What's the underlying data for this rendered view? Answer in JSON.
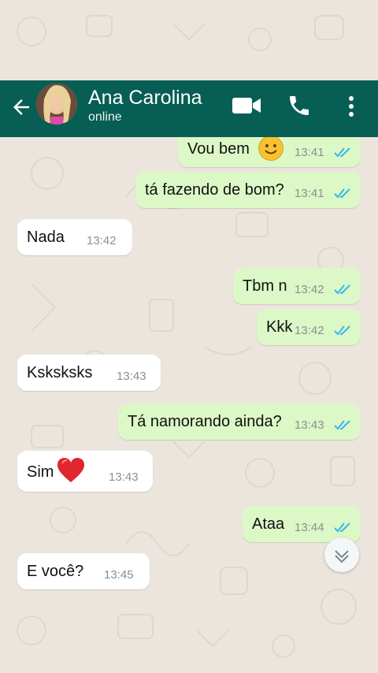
{
  "header": {
    "name": "Ana Carolina",
    "status": "online"
  },
  "messages": [
    {
      "text": "Vou bem",
      "time": "13:41",
      "direction": "outgoing",
      "read": true,
      "emoji": "smiling-face"
    },
    {
      "text": "tá fazendo de bom?",
      "time": "13:41",
      "direction": "outgoing",
      "read": true
    },
    {
      "text": "Nada",
      "time": "13:42",
      "direction": "incoming"
    },
    {
      "text": "Tbm n",
      "time": "13:42",
      "direction": "outgoing",
      "read": true
    },
    {
      "text": "Kkk",
      "time": "13:42",
      "direction": "outgoing",
      "read": true
    },
    {
      "text": "Ksksksks",
      "time": "13:43",
      "direction": "incoming"
    },
    {
      "text": "Tá namorando ainda?",
      "time": "13:43",
      "direction": "outgoing",
      "read": true
    },
    {
      "text": "Sim",
      "time": "13:43",
      "direction": "incoming",
      "emoji": "red-heart"
    },
    {
      "text": "Ataa",
      "time": "13:44",
      "direction": "outgoing",
      "read": true
    },
    {
      "text": "E você?",
      "time": "13:45",
      "direction": "incoming"
    }
  ],
  "colors": {
    "header": "#075e54",
    "outgoing_bubble": "#dcf8c6",
    "incoming_bubble": "#ffffff",
    "read_ticks": "#34b7f1",
    "background": "#ece5dd"
  },
  "icons": {
    "back": "arrow-left-icon",
    "video": "video-camera-icon",
    "call": "phone-icon",
    "menu": "more-vertical-icon",
    "scroll": "chevron-down-icon"
  }
}
